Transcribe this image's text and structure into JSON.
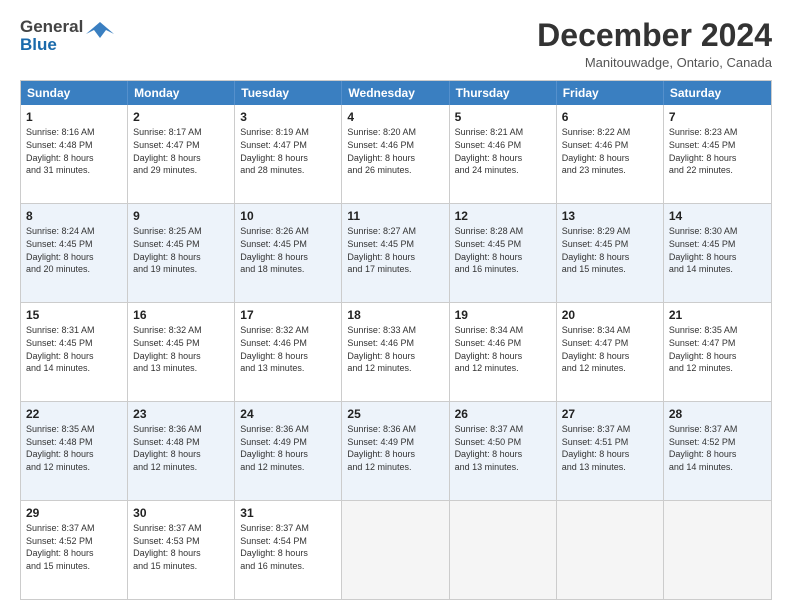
{
  "header": {
    "logo_line1": "General",
    "logo_line2": "Blue",
    "month_title": "December 2024",
    "location": "Manitouwadge, Ontario, Canada"
  },
  "weekdays": [
    "Sunday",
    "Monday",
    "Tuesday",
    "Wednesday",
    "Thursday",
    "Friday",
    "Saturday"
  ],
  "rows": [
    [
      {
        "day": "1",
        "lines": [
          "Sunrise: 8:16 AM",
          "Sunset: 4:48 PM",
          "Daylight: 8 hours",
          "and 31 minutes."
        ]
      },
      {
        "day": "2",
        "lines": [
          "Sunrise: 8:17 AM",
          "Sunset: 4:47 PM",
          "Daylight: 8 hours",
          "and 29 minutes."
        ]
      },
      {
        "day": "3",
        "lines": [
          "Sunrise: 8:19 AM",
          "Sunset: 4:47 PM",
          "Daylight: 8 hours",
          "and 28 minutes."
        ]
      },
      {
        "day": "4",
        "lines": [
          "Sunrise: 8:20 AM",
          "Sunset: 4:46 PM",
          "Daylight: 8 hours",
          "and 26 minutes."
        ]
      },
      {
        "day": "5",
        "lines": [
          "Sunrise: 8:21 AM",
          "Sunset: 4:46 PM",
          "Daylight: 8 hours",
          "and 24 minutes."
        ]
      },
      {
        "day": "6",
        "lines": [
          "Sunrise: 8:22 AM",
          "Sunset: 4:46 PM",
          "Daylight: 8 hours",
          "and 23 minutes."
        ]
      },
      {
        "day": "7",
        "lines": [
          "Sunrise: 8:23 AM",
          "Sunset: 4:45 PM",
          "Daylight: 8 hours",
          "and 22 minutes."
        ]
      }
    ],
    [
      {
        "day": "8",
        "lines": [
          "Sunrise: 8:24 AM",
          "Sunset: 4:45 PM",
          "Daylight: 8 hours",
          "and 20 minutes."
        ]
      },
      {
        "day": "9",
        "lines": [
          "Sunrise: 8:25 AM",
          "Sunset: 4:45 PM",
          "Daylight: 8 hours",
          "and 19 minutes."
        ]
      },
      {
        "day": "10",
        "lines": [
          "Sunrise: 8:26 AM",
          "Sunset: 4:45 PM",
          "Daylight: 8 hours",
          "and 18 minutes."
        ]
      },
      {
        "day": "11",
        "lines": [
          "Sunrise: 8:27 AM",
          "Sunset: 4:45 PM",
          "Daylight: 8 hours",
          "and 17 minutes."
        ]
      },
      {
        "day": "12",
        "lines": [
          "Sunrise: 8:28 AM",
          "Sunset: 4:45 PM",
          "Daylight: 8 hours",
          "and 16 minutes."
        ]
      },
      {
        "day": "13",
        "lines": [
          "Sunrise: 8:29 AM",
          "Sunset: 4:45 PM",
          "Daylight: 8 hours",
          "and 15 minutes."
        ]
      },
      {
        "day": "14",
        "lines": [
          "Sunrise: 8:30 AM",
          "Sunset: 4:45 PM",
          "Daylight: 8 hours",
          "and 14 minutes."
        ]
      }
    ],
    [
      {
        "day": "15",
        "lines": [
          "Sunrise: 8:31 AM",
          "Sunset: 4:45 PM",
          "Daylight: 8 hours",
          "and 14 minutes."
        ]
      },
      {
        "day": "16",
        "lines": [
          "Sunrise: 8:32 AM",
          "Sunset: 4:45 PM",
          "Daylight: 8 hours",
          "and 13 minutes."
        ]
      },
      {
        "day": "17",
        "lines": [
          "Sunrise: 8:32 AM",
          "Sunset: 4:46 PM",
          "Daylight: 8 hours",
          "and 13 minutes."
        ]
      },
      {
        "day": "18",
        "lines": [
          "Sunrise: 8:33 AM",
          "Sunset: 4:46 PM",
          "Daylight: 8 hours",
          "and 12 minutes."
        ]
      },
      {
        "day": "19",
        "lines": [
          "Sunrise: 8:34 AM",
          "Sunset: 4:46 PM",
          "Daylight: 8 hours",
          "and 12 minutes."
        ]
      },
      {
        "day": "20",
        "lines": [
          "Sunrise: 8:34 AM",
          "Sunset: 4:47 PM",
          "Daylight: 8 hours",
          "and 12 minutes."
        ]
      },
      {
        "day": "21",
        "lines": [
          "Sunrise: 8:35 AM",
          "Sunset: 4:47 PM",
          "Daylight: 8 hours",
          "and 12 minutes."
        ]
      }
    ],
    [
      {
        "day": "22",
        "lines": [
          "Sunrise: 8:35 AM",
          "Sunset: 4:48 PM",
          "Daylight: 8 hours",
          "and 12 minutes."
        ]
      },
      {
        "day": "23",
        "lines": [
          "Sunrise: 8:36 AM",
          "Sunset: 4:48 PM",
          "Daylight: 8 hours",
          "and 12 minutes."
        ]
      },
      {
        "day": "24",
        "lines": [
          "Sunrise: 8:36 AM",
          "Sunset: 4:49 PM",
          "Daylight: 8 hours",
          "and 12 minutes."
        ]
      },
      {
        "day": "25",
        "lines": [
          "Sunrise: 8:36 AM",
          "Sunset: 4:49 PM",
          "Daylight: 8 hours",
          "and 12 minutes."
        ]
      },
      {
        "day": "26",
        "lines": [
          "Sunrise: 8:37 AM",
          "Sunset: 4:50 PM",
          "Daylight: 8 hours",
          "and 13 minutes."
        ]
      },
      {
        "day": "27",
        "lines": [
          "Sunrise: 8:37 AM",
          "Sunset: 4:51 PM",
          "Daylight: 8 hours",
          "and 13 minutes."
        ]
      },
      {
        "day": "28",
        "lines": [
          "Sunrise: 8:37 AM",
          "Sunset: 4:52 PM",
          "Daylight: 8 hours",
          "and 14 minutes."
        ]
      }
    ],
    [
      {
        "day": "29",
        "lines": [
          "Sunrise: 8:37 AM",
          "Sunset: 4:52 PM",
          "Daylight: 8 hours",
          "and 15 minutes."
        ]
      },
      {
        "day": "30",
        "lines": [
          "Sunrise: 8:37 AM",
          "Sunset: 4:53 PM",
          "Daylight: 8 hours",
          "and 15 minutes."
        ]
      },
      {
        "day": "31",
        "lines": [
          "Sunrise: 8:37 AM",
          "Sunset: 4:54 PM",
          "Daylight: 8 hours",
          "and 16 minutes."
        ]
      },
      {
        "day": "",
        "lines": []
      },
      {
        "day": "",
        "lines": []
      },
      {
        "day": "",
        "lines": []
      },
      {
        "day": "",
        "lines": []
      }
    ]
  ]
}
